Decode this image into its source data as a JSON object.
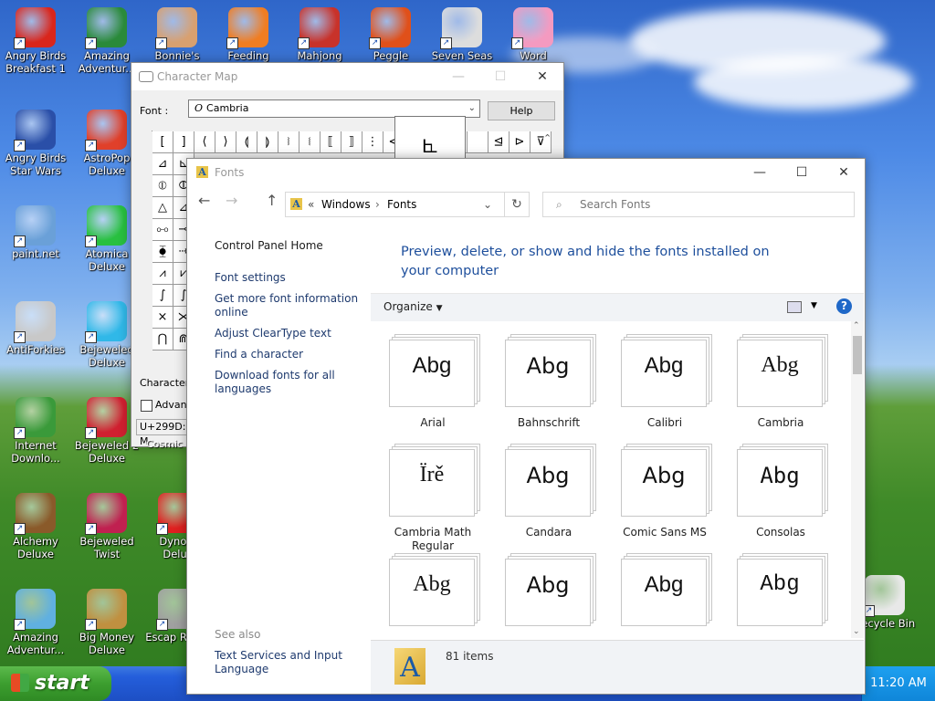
{
  "desktop": {
    "icons": [
      {
        "label": "Angry Birds Breakfast 1",
        "icon": "angry-birds-icon",
        "color": "#d9261c"
      },
      {
        "label": "Amazing Adventur...",
        "icon": "compass-icon",
        "color": "#2a8a3a"
      },
      {
        "label": "Bonnie's",
        "icon": "bonnie-icon",
        "color": "#d8a070"
      },
      {
        "label": "Feeding",
        "icon": "fish-icon",
        "color": "#f07d22"
      },
      {
        "label": "Mahjong",
        "icon": "torii-icon",
        "color": "#c8322a"
      },
      {
        "label": "Peggle",
        "icon": "peggle-icon",
        "color": "#e0501a"
      },
      {
        "label": "Seven Seas",
        "icon": "pirate-icon",
        "color": "#dddddd"
      },
      {
        "label": "Word",
        "icon": "flower-icon",
        "color": "#f49ac0"
      },
      {
        "label": "Angry Birds Star Wars",
        "icon": "star-wars-icon",
        "color": "#2a4fa8"
      },
      {
        "label": "AstroPop Deluxe",
        "icon": "astropop-icon",
        "color": "#e0402a"
      },
      {
        "label": "paint.net",
        "icon": "paint-icon",
        "color": "#6aa0d8"
      },
      {
        "label": "Atomica Deluxe",
        "icon": "atomica-icon",
        "color": "#28c040"
      },
      {
        "label": "AntiForkies",
        "icon": "antiforkies-icon",
        "color": "#c8c8c8"
      },
      {
        "label": "Bejeweled Deluxe",
        "icon": "gem-icon",
        "color": "#30b8e8"
      },
      {
        "label": "Internet Downlo...",
        "icon": "idm-icon",
        "color": "#3a9a3a"
      },
      {
        "label": "Bejeweled 2 Deluxe",
        "icon": "gem2-icon",
        "color": "#d02030"
      },
      {
        "label": "Alchemy Deluxe",
        "icon": "alchemy-icon",
        "color": "#8a5a2a"
      },
      {
        "label": "Bejeweled Twist",
        "icon": "twist-icon",
        "color": "#c02050"
      },
      {
        "label": "Dynom Delux",
        "icon": "dynomite-icon",
        "color": "#e02020"
      },
      {
        "label": "Amazing Adventur...",
        "icon": "diamond-icon",
        "color": "#60b0e0"
      },
      {
        "label": "Big Money Deluxe",
        "icon": "money-bag-icon",
        "color": "#c09040"
      },
      {
        "label": "Escap Rosec",
        "icon": "escape-icon",
        "color": "#a0a0a0"
      },
      {
        "label": "Recycle Bin",
        "icon": "recycle-bin-icon",
        "color": "#e8e8e8"
      }
    ]
  },
  "taskbar": {
    "start_label": "start",
    "clock": "11:20 AM"
  },
  "charmap": {
    "title": "Character Map",
    "font_label": "Font :",
    "font_value": "Cambria",
    "help_label": "Help",
    "characters_label": "Characters",
    "advanced_label": "Advanc",
    "status_text": "U+299D: M",
    "status_font": "Cosmic",
    "zoom_char": "⦜",
    "row1": [
      "[",
      "]",
      "⟨",
      "⟩",
      "⟬",
      "⟭",
      "⧘",
      "⧙",
      "⟦",
      "⟧",
      "⋮",
      "⊲",
      "",
      "",
      "",
      "",
      "⊴",
      "⊳",
      "⊽"
    ],
    "col_chars": [
      "⊿",
      "⦶",
      "△",
      "⧟",
      "⧳",
      "⩘",
      "∫",
      "×",
      "⋂"
    ],
    "col2_chars": [
      "⊾",
      "⦷",
      "⊿",
      "⊸",
      "⇢",
      "⩗",
      "∫",
      "⋊",
      "⋒"
    ]
  },
  "fonts": {
    "title": "Fonts",
    "breadcrumb_root": "Windows",
    "breadcrumb_current": "Fonts",
    "search_placeholder": "Search Fonts",
    "heading": "Preview, delete, or show and hide the fonts installed on your computer",
    "organize_label": "Organize",
    "left_links": [
      "Control Panel Home",
      "Font settings",
      "Get more font information online",
      "Adjust ClearType text",
      "Find a character",
      "Download fonts for all languages"
    ],
    "see_also_label": "See also",
    "see_also_link": "Text Services and Input Language",
    "items_count": "81 items",
    "cards": [
      {
        "name": "Arial",
        "sample": "Abg",
        "family": "\"Liberation Sans\", sans-serif"
      },
      {
        "name": "Bahnschrift",
        "sample": "Abg",
        "family": "\"DejaVu Sans\", sans-serif"
      },
      {
        "name": "Calibri",
        "sample": "Abg",
        "family": "\"Liberation Sans\", sans-serif"
      },
      {
        "name": "Cambria",
        "sample": "Abg",
        "family": "\"Liberation Serif\", serif"
      },
      {
        "name": "Cambria Math Regular",
        "sample": "Ïrě",
        "family": "\"Liberation Serif\", serif"
      },
      {
        "name": "Candara",
        "sample": "Abg",
        "family": "\"DejaVu Sans\", sans-serif"
      },
      {
        "name": "Comic Sans MS",
        "sample": "Abg",
        "family": "\"DejaVu Sans\", sans-serif"
      },
      {
        "name": "Consolas",
        "sample": "Abg",
        "family": "\"DejaVu Sans Mono\", monospace"
      },
      {
        "name": "",
        "sample": "Abg",
        "family": "\"Liberation Serif\", serif"
      },
      {
        "name": "",
        "sample": "Abg",
        "family": "\"DejaVu Sans\", sans-serif"
      },
      {
        "name": "",
        "sample": "Abg",
        "family": "\"Liberation Sans\", sans-serif"
      },
      {
        "name": "",
        "sample": "Abg",
        "family": "\"Liberation Mono\", monospace"
      }
    ]
  }
}
